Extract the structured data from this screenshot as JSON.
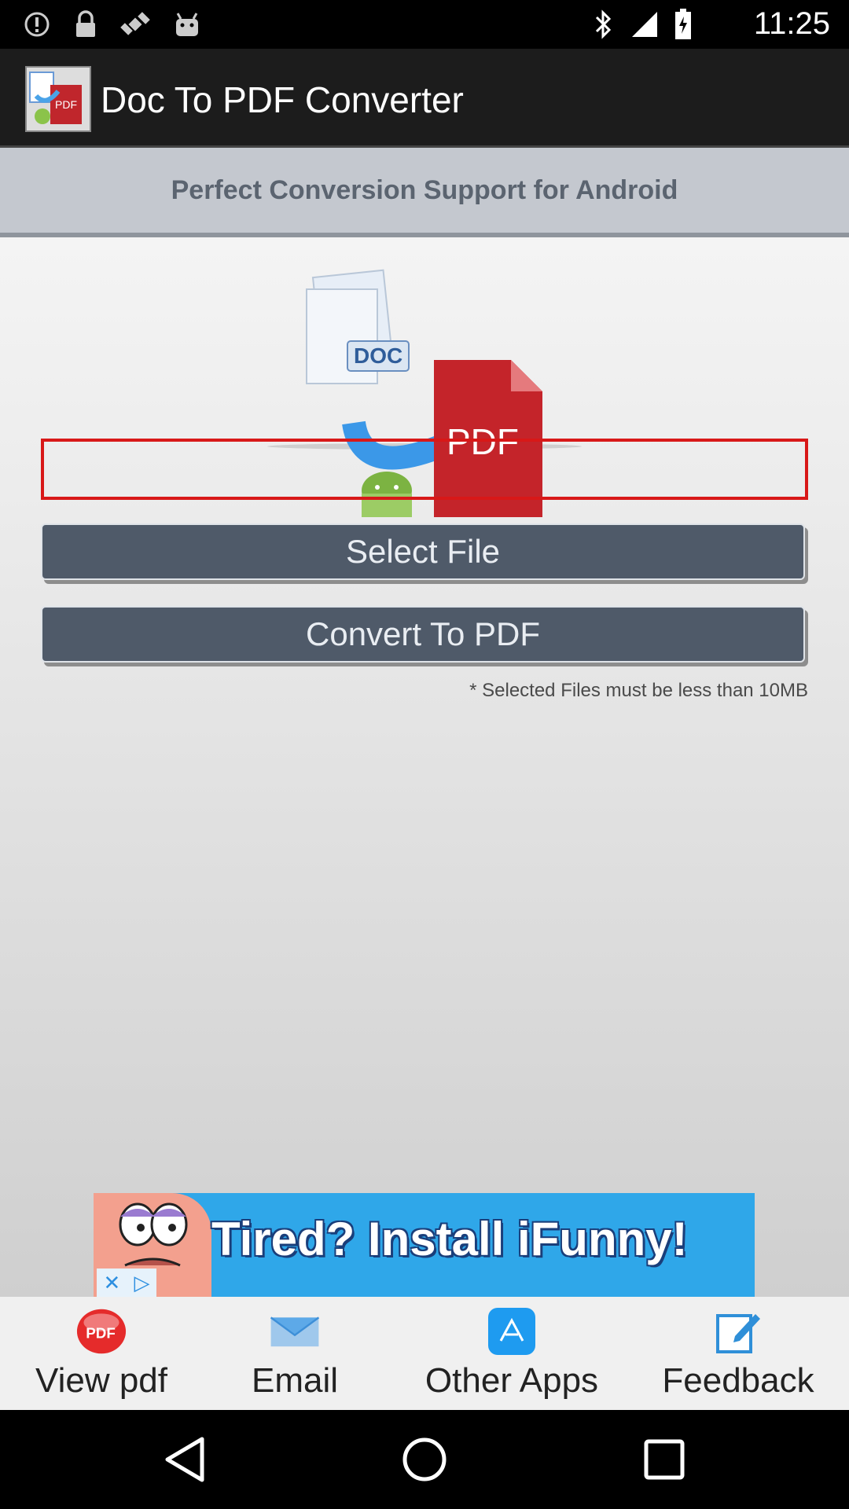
{
  "status_bar": {
    "time": "11:25",
    "left_icons": [
      "alert-icon",
      "lock-icon",
      "satellite-icon",
      "android-icon"
    ],
    "right_icons": [
      "bluetooth-icon",
      "signal-icon",
      "battery-icon"
    ]
  },
  "action_bar": {
    "title": "Doc To PDF Converter",
    "icon": "app-logo-icon"
  },
  "banner": {
    "text": "Perfect Conversion Support for Android"
  },
  "hero": {
    "doc_label": "DOC",
    "pdf_label": "PDF"
  },
  "buttons": {
    "select_file": "Select File",
    "convert": "Convert To PDF"
  },
  "note": "* Selected Files must be less than 10MB",
  "ad": {
    "text": "Tired? Install iFunny!",
    "close_icon": "close-icon",
    "adchoices_icon": "adchoices-icon"
  },
  "bottom_menu": {
    "items": [
      {
        "label": "View pdf",
        "icon": "pdf-icon",
        "icon_text": "PDF"
      },
      {
        "label": "Email",
        "icon": "envelope-icon"
      },
      {
        "label": "Other Apps",
        "icon": "app-store-icon"
      },
      {
        "label": "Feedback",
        "icon": "edit-icon"
      }
    ]
  },
  "colors": {
    "button_bg": "#4f5a69",
    "banner_bg": "#c4c8cf",
    "highlight_frame": "#d81818",
    "ad_bg": "#2fa7e9"
  }
}
